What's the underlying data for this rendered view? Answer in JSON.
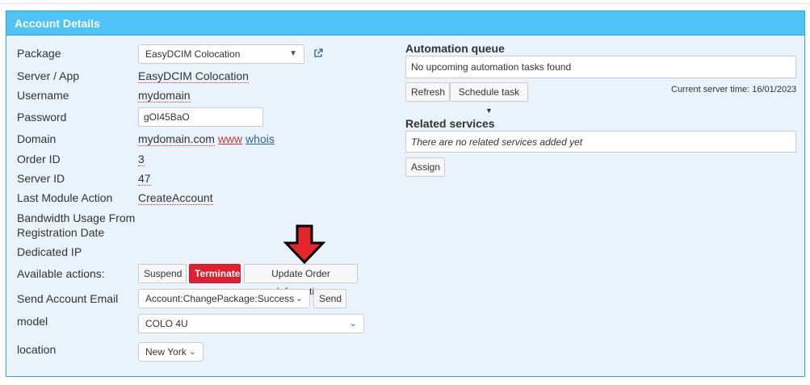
{
  "panel": {
    "title": "Account Details"
  },
  "fields": {
    "package": {
      "label": "Package",
      "value": "EasyDCIM Colocation"
    },
    "server_app": {
      "label": "Server / App",
      "value": "EasyDCIM Colocation"
    },
    "username": {
      "label": "Username",
      "value": "mydomain"
    },
    "password": {
      "label": "Password",
      "value": "gOI45BaO"
    },
    "domain": {
      "label": "Domain",
      "value": "mydomain.com",
      "www": "www",
      "whois": "whois"
    },
    "order_id": {
      "label": "Order ID",
      "value": "3"
    },
    "server_id": {
      "label": "Server ID",
      "value": "47"
    },
    "last_module_action": {
      "label": "Last Module Action",
      "value": "CreateAccount"
    },
    "bandwidth": {
      "label_line1": "Bandwidth Usage From",
      "label_line2": "Registration Date"
    },
    "dedicated_ip": {
      "label": "Dedicated IP"
    },
    "available_actions": {
      "label": "Available actions:",
      "suspend": "Suspend",
      "terminate": "Terminate",
      "update_order": "Update Order Information"
    },
    "send_email": {
      "label": "Send Account Email",
      "selected": "Account:ChangePackage:Success",
      "send": "Send"
    },
    "model": {
      "label": "model",
      "selected": "COLO 4U"
    },
    "location": {
      "label": "location",
      "selected": "New York"
    }
  },
  "automation": {
    "title": "Automation queue",
    "message": "No upcoming automation tasks found",
    "refresh": "Refresh",
    "schedule": "Schedule task",
    "server_time": "Current server time: 16/01/2023"
  },
  "related": {
    "title": "Related services",
    "message": "There are no related services added yet",
    "assign": "Assign"
  },
  "colors": {
    "header": "#4fc3f7",
    "panel_bg": "#eaf3fb",
    "terminate": "#e0202e",
    "arrow": "#e3262b"
  },
  "icons": {
    "external_link": "external-link-icon",
    "arrow": "down-arrow-icon"
  }
}
